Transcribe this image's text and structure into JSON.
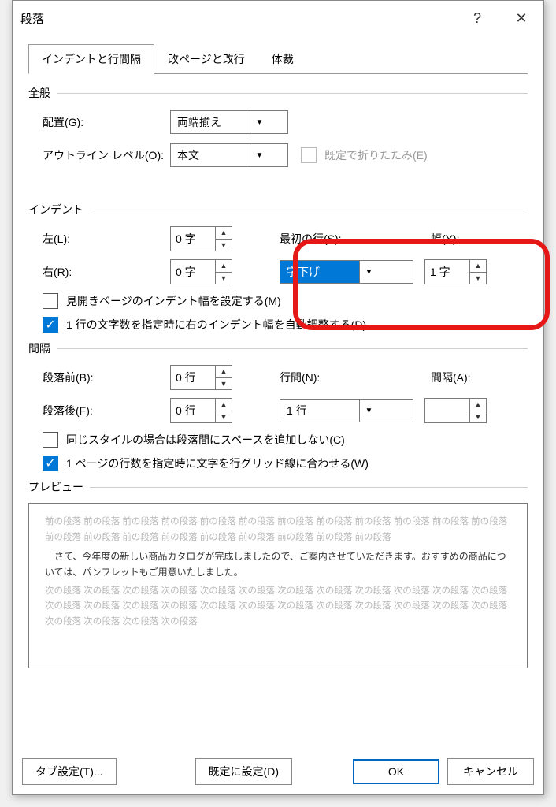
{
  "title": "段落",
  "title_buttons": {
    "help": "?",
    "close": "✕"
  },
  "tabs": [
    "インデントと行間隔",
    "改ページと改行",
    "体裁"
  ],
  "general": {
    "label": "全般",
    "alignment_label": "配置(G):",
    "alignment_value": "両端揃え",
    "outline_label": "アウトライン レベル(O):",
    "outline_value": "本文",
    "collapsed_label": "既定で折りたたみ(E)"
  },
  "indent": {
    "label": "インデント",
    "left_label": "左(L):",
    "left_value": "0 字",
    "right_label": "右(R):",
    "right_value": "0 字",
    "firstline_label": "最初の行(S):",
    "firstline_value": "字下げ",
    "width_label": "幅(Y):",
    "width_value": "1 字",
    "mirror_label": "見開きページのインデント幅を設定する(M)",
    "autoadjust_label": "1 行の文字数を指定時に右のインデント幅を自動調整する(D)"
  },
  "spacing": {
    "label": "間隔",
    "before_label": "段落前(B):",
    "before_value": "0 行",
    "after_label": "段落後(F):",
    "after_value": "0 行",
    "line_label": "行間(N):",
    "line_value": "1 行",
    "at_label": "間隔(A):",
    "at_value": "",
    "nospace_label": "同じスタイルの場合は段落間にスペースを追加しない(C)",
    "snapgrid_label": "1 ページの行数を指定時に文字を行グリッド線に合わせる(W)"
  },
  "preview": {
    "label": "プレビュー",
    "before_text": "前の段落 前の段落 前の段落 前の段落 前の段落 前の段落 前の段落 前の段落 前の段落 前の段落 前の段落 前の段落 前の段落 前の段落 前の段落 前の段落 前の段落 前の段落 前の段落 前の段落 前の段落",
    "sample": "　さて、今年度の新しい商品カタログが完成しましたので、ご案内させていただきます。おすすめの商品については、パンフレットもご用意いたしました。",
    "after_text": "次の段落 次の段落 次の段落 次の段落 次の段落 次の段落 次の段落 次の段落 次の段落 次の段落 次の段落 次の段落 次の段落 次の段落 次の段落 次の段落 次の段落 次の段落 次の段落 次の段落 次の段落 次の段落 次の段落 次の段落 次の段落 次の段落 次の段落 次の段落"
  },
  "footer": {
    "tabs": "タブ設定(T)...",
    "default": "既定に設定(D)",
    "ok": "OK",
    "cancel": "キャンセル"
  }
}
